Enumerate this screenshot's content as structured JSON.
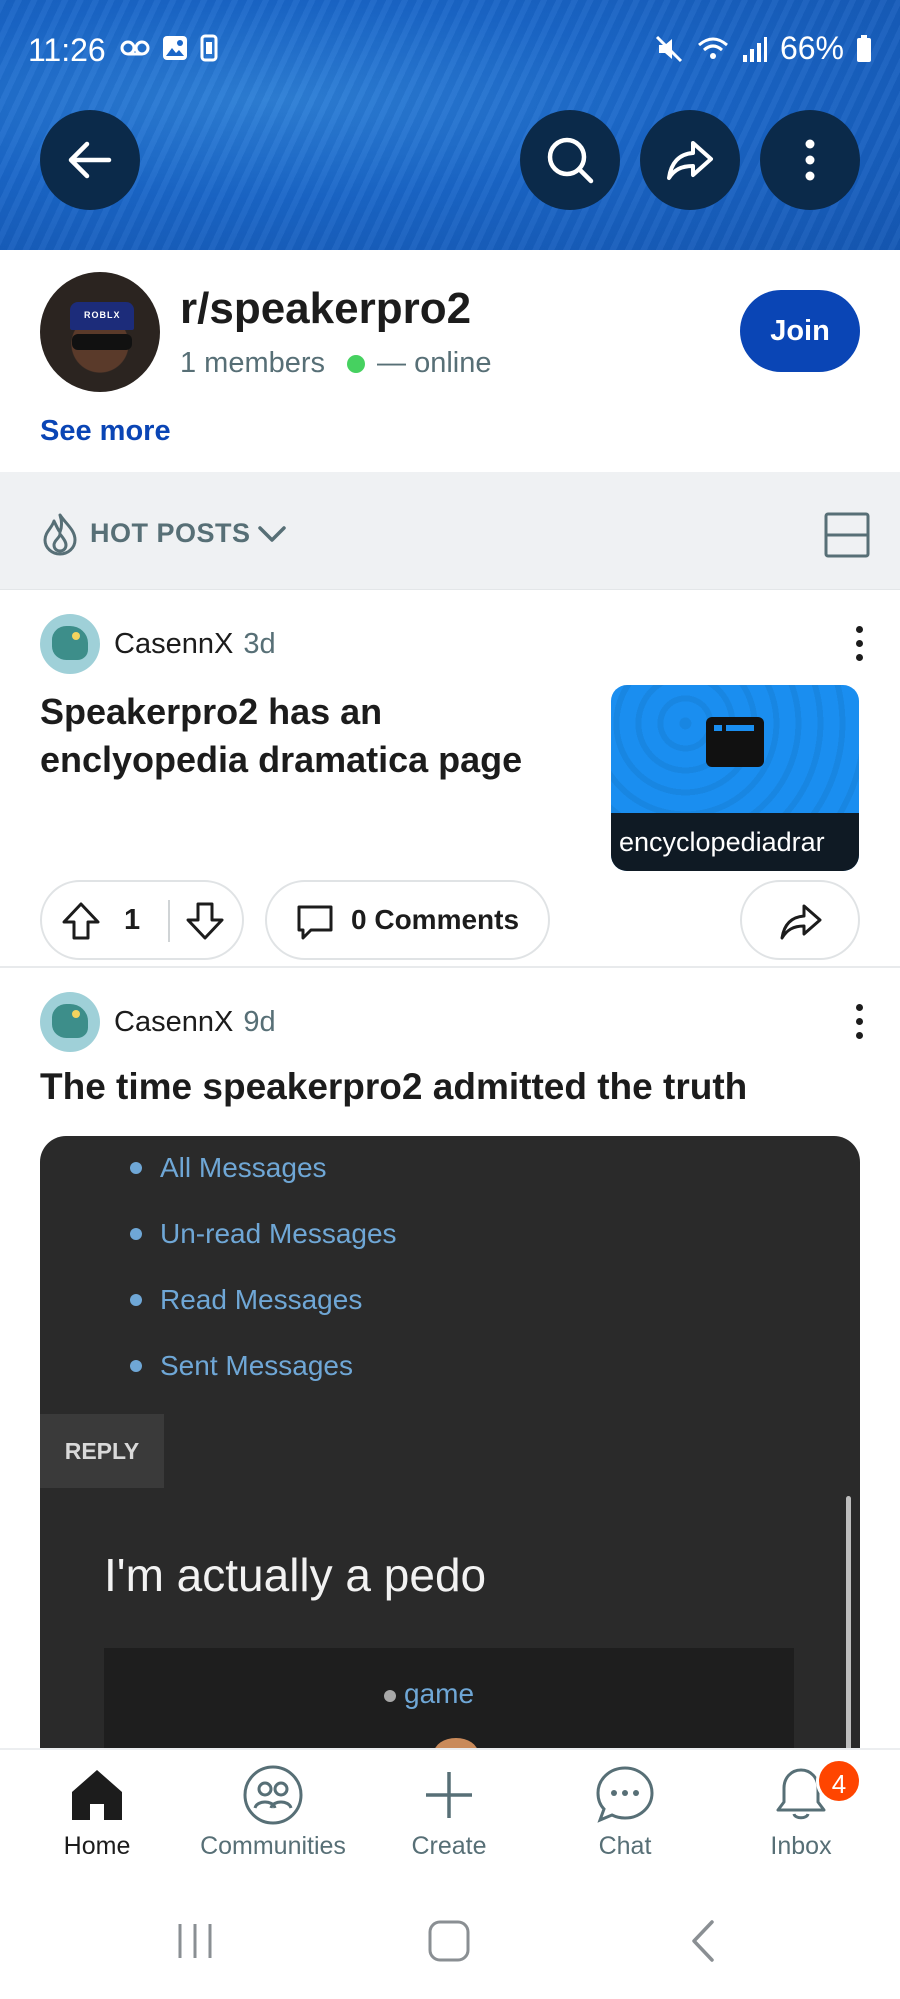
{
  "status_bar": {
    "time": "11:26",
    "battery": "66%"
  },
  "header": {
    "icons": [
      "back-arrow-icon",
      "search-icon",
      "share-icon",
      "more-vertical-icon"
    ]
  },
  "community": {
    "name": "r/speakerpro2",
    "members": "1 members",
    "online": "— online",
    "join_label": "Join",
    "see_more": "See more",
    "avatar_cap_text": "ROBLX"
  },
  "sort": {
    "label": "HOT POSTS"
  },
  "posts": [
    {
      "author": "CasennX",
      "age": "3d",
      "title": "Speakerpro2 has an enclyopedia dramatica page",
      "thumbnail_caption": "encyclopediadrar",
      "votes": "1",
      "comments": "0 Comments"
    },
    {
      "author": "CasennX",
      "age": "9d",
      "title": "The time speakerpro2 admitted the truth",
      "image": {
        "menu_items": [
          "All Messages",
          "Un-read Messages",
          "Read Messages",
          "Sent Messages"
        ],
        "reply_label": "REPLY",
        "quote": "I'm actually a pedo",
        "inner_link": "game"
      }
    }
  ],
  "bottom_nav": {
    "items": [
      {
        "label": "Home",
        "icon": "home-icon",
        "active": true
      },
      {
        "label": "Communities",
        "icon": "communities-icon"
      },
      {
        "label": "Create",
        "icon": "plus-icon"
      },
      {
        "label": "Chat",
        "icon": "chat-icon"
      },
      {
        "label": "Inbox",
        "icon": "bell-icon",
        "badge": "4"
      }
    ]
  },
  "colors": {
    "banner": "#1a66c8",
    "join_button": "#0a45b5",
    "online_dot": "#46d160",
    "badge": "#ff4500"
  }
}
